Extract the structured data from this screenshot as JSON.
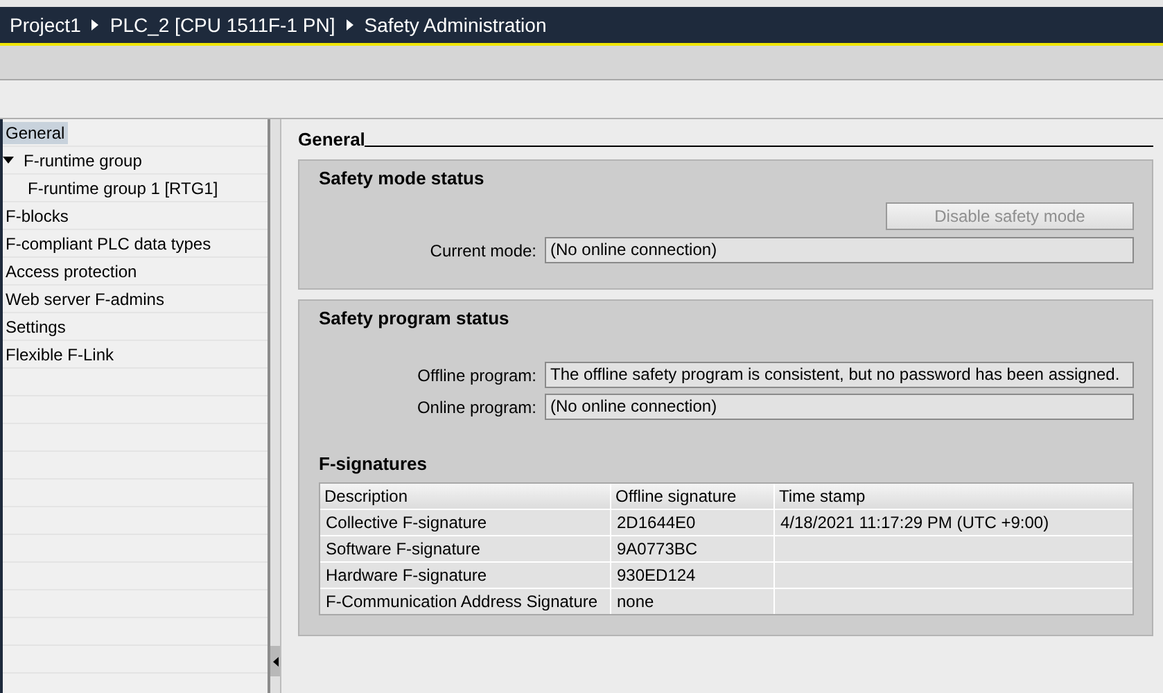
{
  "breadcrumb": [
    "Project1",
    "PLC_2 [CPU 1511F-1 PN]",
    "Safety Administration"
  ],
  "sidebar": {
    "items": [
      {
        "label": "General",
        "selected": true
      },
      {
        "label": "F-runtime group",
        "selected": false,
        "expanded": true,
        "children": [
          {
            "label": "F-runtime group 1 [RTG1]",
            "selected": false
          }
        ]
      },
      {
        "label": "F-blocks",
        "selected": false
      },
      {
        "label": "F-compliant PLC data types",
        "selected": false
      },
      {
        "label": "Access protection",
        "selected": false
      },
      {
        "label": "Web server F-admins",
        "selected": false
      },
      {
        "label": "Settings",
        "selected": false
      },
      {
        "label": "Flexible F-Link",
        "selected": false
      }
    ]
  },
  "section_title": "General",
  "safety_mode": {
    "title": "Safety mode status",
    "button": {
      "label": "Disable safety mode",
      "disabled": true
    },
    "fields": [
      {
        "label": "Current mode:",
        "value": "(No online connection)"
      }
    ]
  },
  "safety_program": {
    "title": "Safety program status",
    "fields": [
      {
        "label": "Offline program:",
        "value": "The offline safety program is consistent, but no password has been assigned."
      },
      {
        "label": "Online program:",
        "value": "(No online connection)"
      }
    ],
    "signatures": {
      "title": "F-signatures",
      "columns": [
        "Description",
        "Offline signature",
        "Time stamp"
      ],
      "rows": [
        {
          "description": "Collective F-signature",
          "offline_signature": "2D1644E0",
          "time_stamp": "4/18/2021 11:17:29 PM (UTC +9:00)"
        },
        {
          "description": "Software F-signature",
          "offline_signature": "9A0773BC"
        },
        {
          "description": "Hardware F-signature",
          "offline_signature": "930ED124"
        },
        {
          "description": "F-Communication Address Signature",
          "offline_signature": "none"
        }
      ]
    }
  }
}
